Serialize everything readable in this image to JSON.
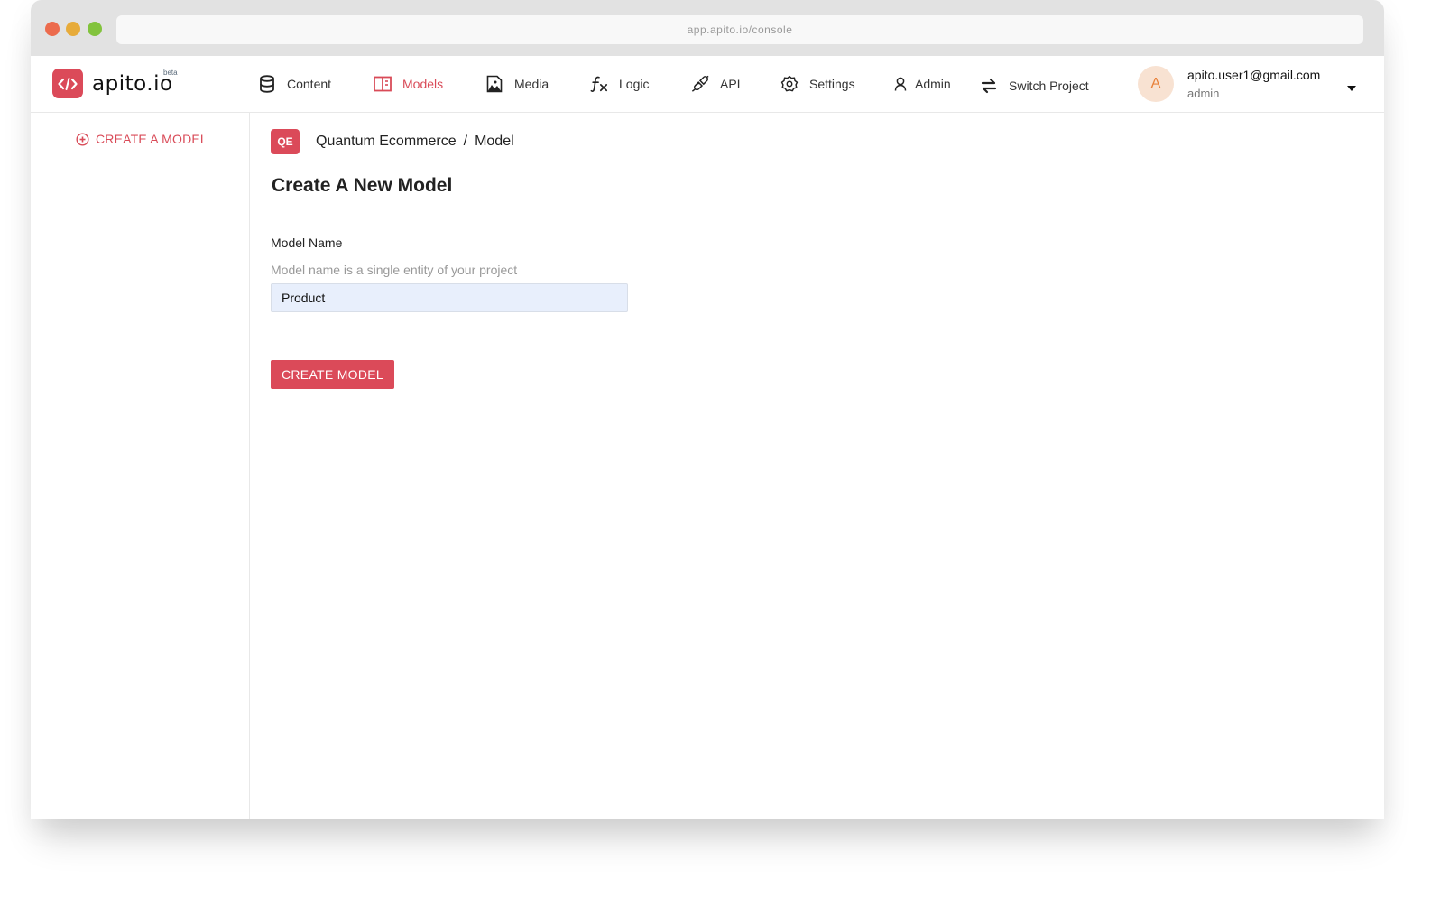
{
  "browser": {
    "url": "app.apito.io/console"
  },
  "brand": {
    "name": "apito.io",
    "badge": "beta",
    "accent_color": "#db4a59"
  },
  "nav": {
    "items": [
      {
        "label": "Content",
        "icon": "database-icon",
        "active": false
      },
      {
        "label": "Models",
        "icon": "models-icon",
        "active": true
      },
      {
        "label": "Media",
        "icon": "image-icon",
        "active": false
      },
      {
        "label": "Logic",
        "icon": "function-icon",
        "active": false
      },
      {
        "label": "API",
        "icon": "plug-icon",
        "active": false
      },
      {
        "label": "Settings",
        "icon": "gear-icon",
        "active": false
      },
      {
        "label": "Admin",
        "icon": "user-icon",
        "active": false
      },
      {
        "label": "Switch Project",
        "icon": "swap-icon",
        "active": false
      }
    ]
  },
  "user": {
    "avatar_initial": "A",
    "email": "apito.user1@gmail.com",
    "role": "admin"
  },
  "sidebar": {
    "create_label": "CREATE A MODEL"
  },
  "breadcrumb": {
    "project_badge": "QE",
    "project": "Quantum Ecommerce",
    "separator": "/",
    "page": "Model"
  },
  "form": {
    "title": "Create A New Model",
    "label": "Model Name",
    "hint": "Model name is a single entity of your project",
    "value": "Product",
    "submit_label": "CREATE MODEL"
  }
}
